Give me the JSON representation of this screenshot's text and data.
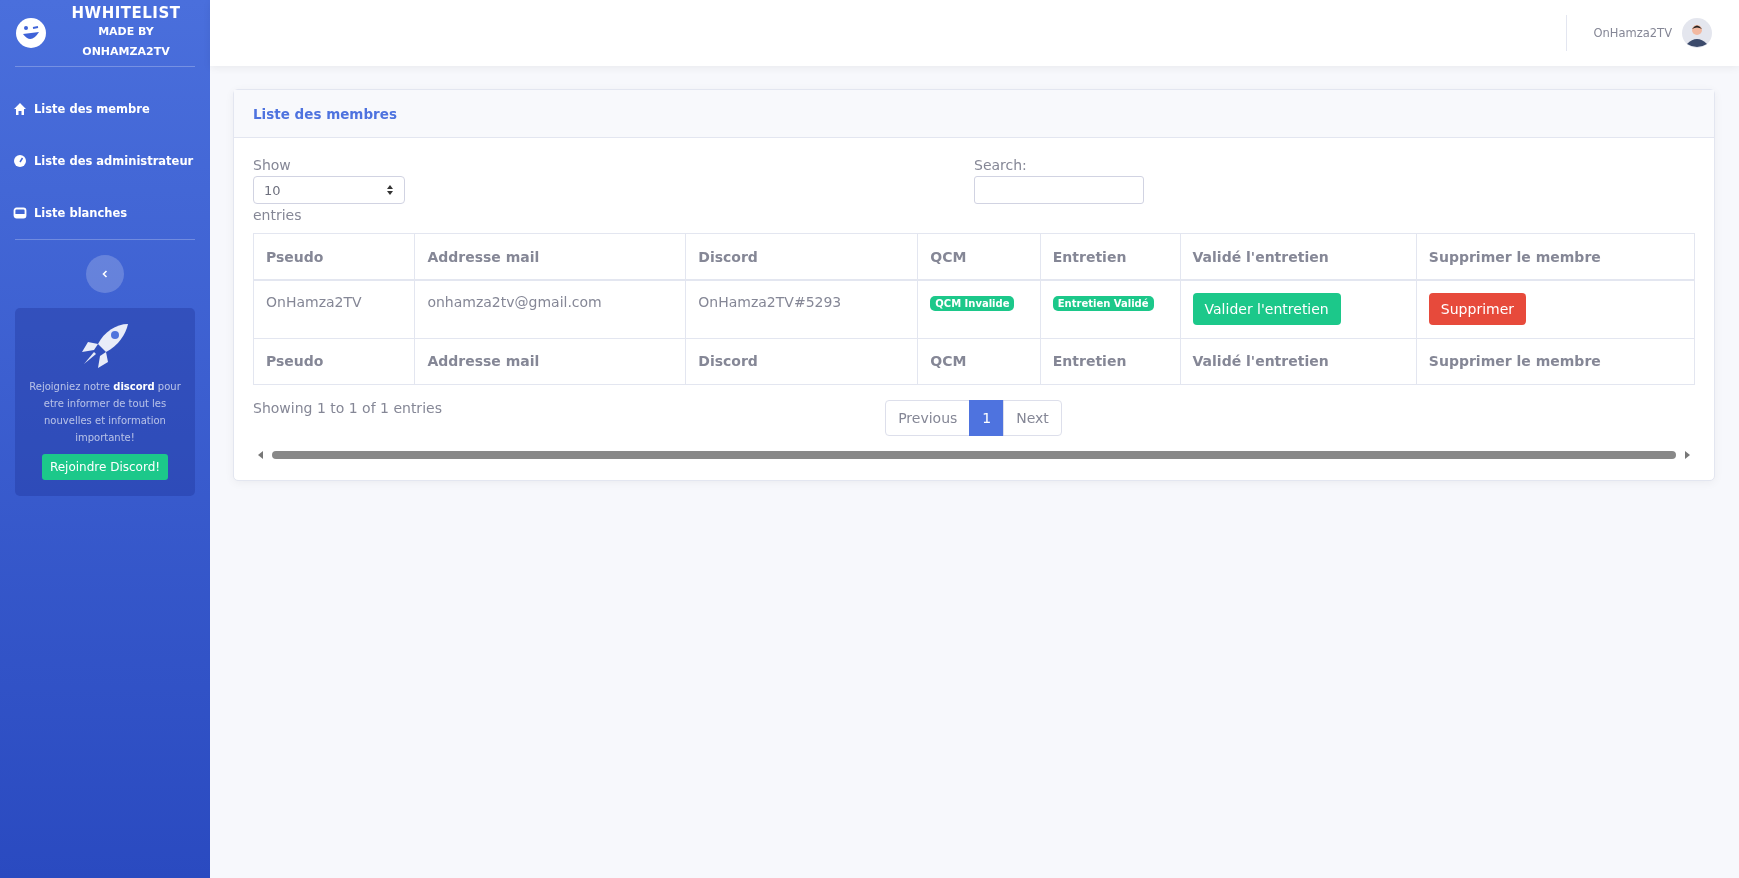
{
  "brand": {
    "title": "HWHITELIST",
    "subtitle_1": "MADE BY",
    "subtitle_2": "ONHAMZA2TV"
  },
  "sidebar": {
    "items": [
      {
        "label": "Liste des membre"
      },
      {
        "label": "Liste des administrateur"
      },
      {
        "label": "Liste blanches"
      }
    ],
    "promo": {
      "text": "Rejoigniez notre **discord** pour etre informer de tout les nouvelles et information importante!",
      "button": "Rejoindre Discord!"
    }
  },
  "topbar": {
    "user": "OnHamza2TV"
  },
  "card": {
    "title": "Liste des membres",
    "length": {
      "before": "Show",
      "value": "10",
      "after": "entries"
    },
    "search": {
      "label": "Search:"
    },
    "table": {
      "columns": [
        "Pseudo",
        "Addresse mail",
        "Discord",
        "QCM",
        "Entretien",
        "Validé l'entretien",
        "Supprimer le membre"
      ],
      "rows": [
        [
          {
            "kind": "text",
            "text": "OnHamza2TV"
          },
          {
            "kind": "text",
            "text": "onhamza2tv@gmail.com"
          },
          {
            "kind": "text",
            "text": "OnHamza2TV#5293"
          },
          {
            "kind": "badge",
            "text": "QCM Invalide"
          },
          {
            "kind": "badge",
            "text": "Entretien Validé"
          },
          {
            "kind": "success-button",
            "text": "Valider l'entretien"
          },
          {
            "kind": "danger-button",
            "text": "Supprimer"
          }
        ]
      ],
      "footer": [
        "Pseudo",
        "Addresse mail",
        "Discord",
        "QCM",
        "Entretien",
        "Validé l'entretien",
        "Supprimer le membre"
      ]
    },
    "info": "Showing 1 to 1 of 1 entries",
    "pagination": [
      {
        "label": "Previous",
        "selected": false
      },
      {
        "label": "1",
        "selected": true
      },
      {
        "label": "Next",
        "selected": false
      }
    ]
  }
}
